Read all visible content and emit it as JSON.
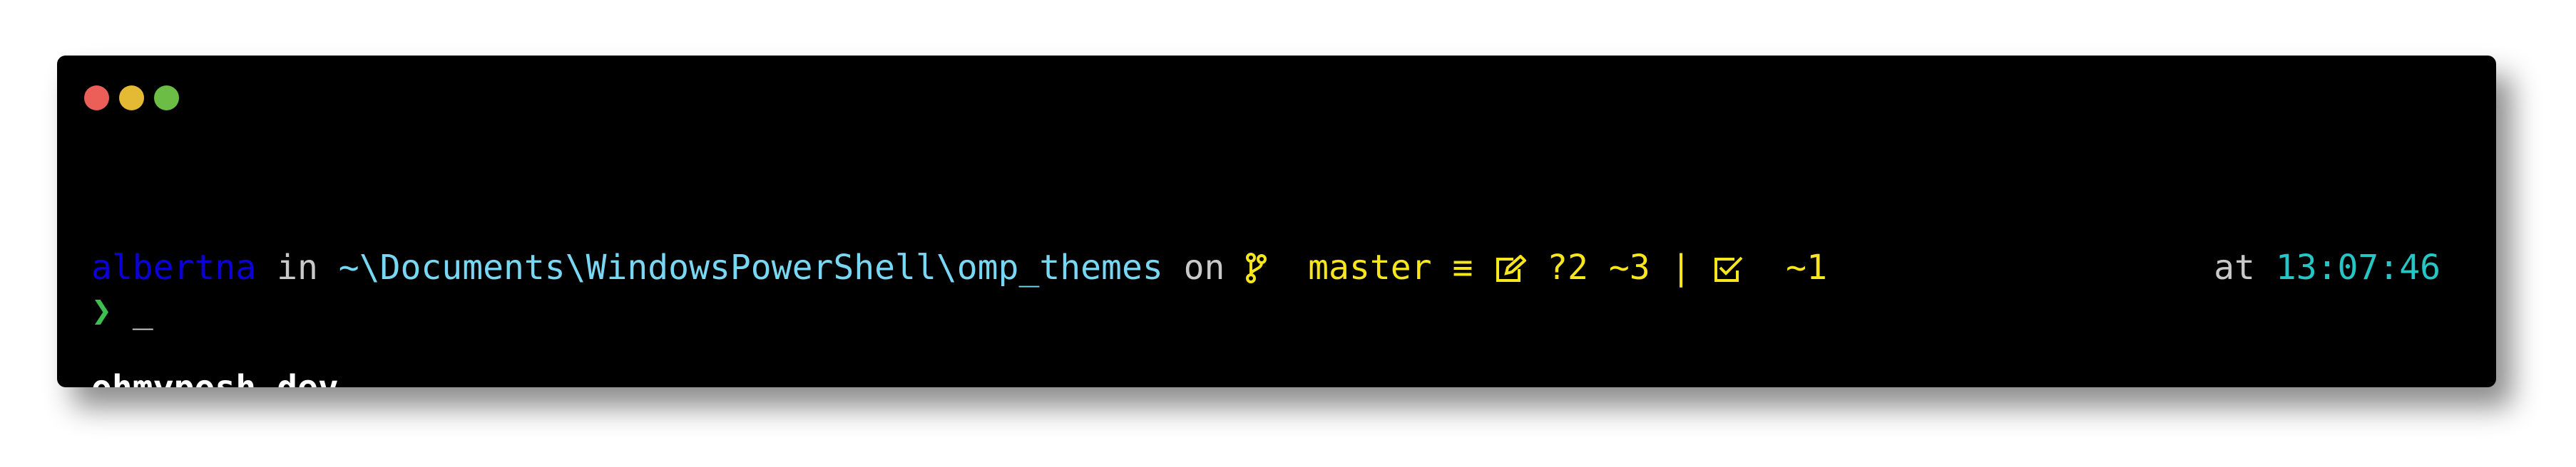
{
  "window": {
    "controls": [
      "close",
      "minimize",
      "maximize"
    ]
  },
  "prompt": {
    "user": "albertna",
    "in_word": "in",
    "path": "~\\Documents\\WindowsPowerShell\\omp_themes",
    "on_word": "on",
    "branch": "master",
    "branch_status": "≡",
    "untracked": "?2",
    "modified": "~3",
    "separator": "|",
    "staged": "~1",
    "at_word": "at",
    "time": "13:07:46",
    "chevron": "❯",
    "cursor": "_"
  },
  "footer": {
    "text": "ohmyposh.dev"
  },
  "colors": {
    "user": "#0c00d8",
    "path": "#78d7f2",
    "git": "#f7e51e",
    "time": "#26c6c6",
    "chevron": "#3fbf4f",
    "dim": "#c9c9c9"
  },
  "icons": [
    "git-branch-icon",
    "edit-icon",
    "check-square-icon"
  ]
}
